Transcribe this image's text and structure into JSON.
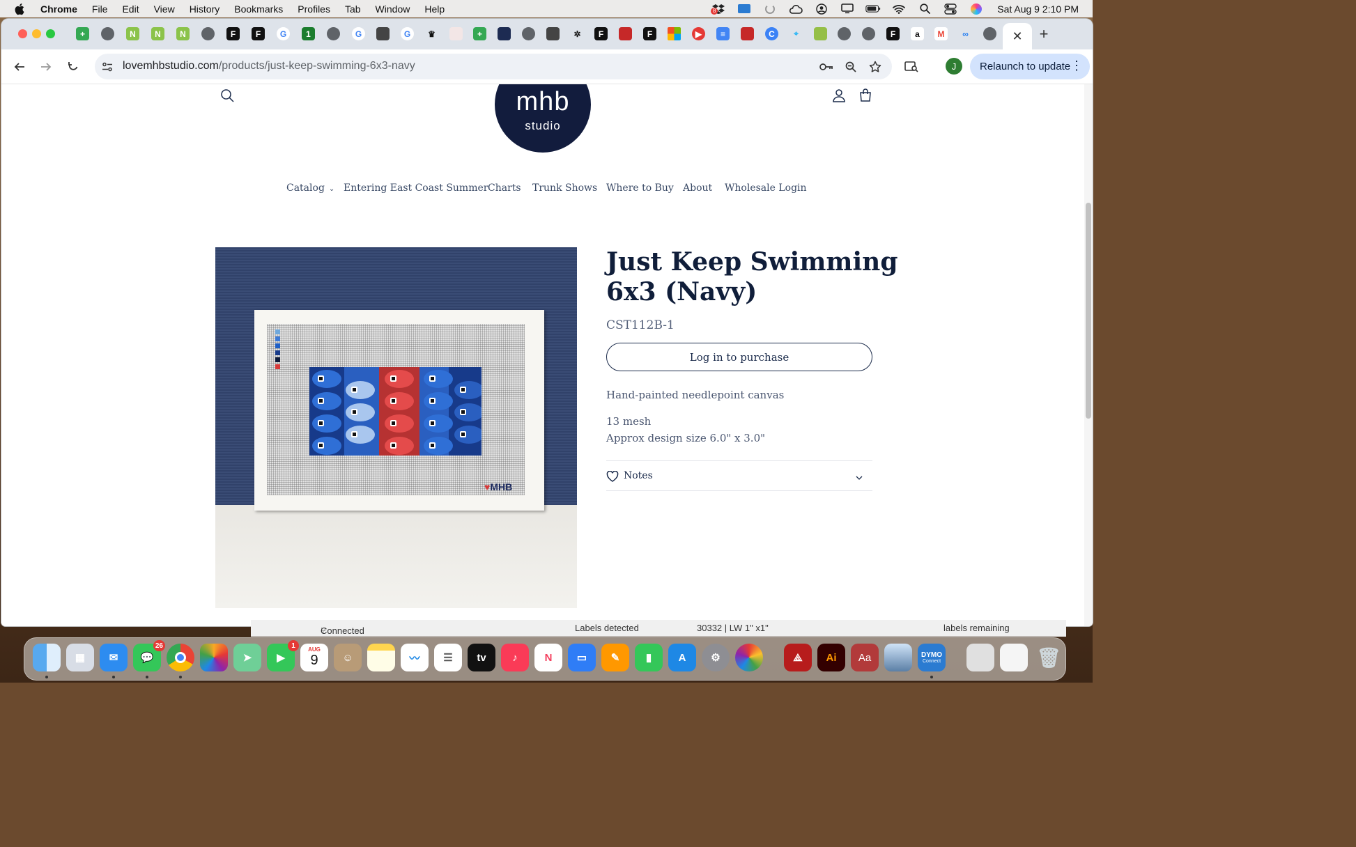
{
  "menubar": {
    "app": "Chrome",
    "items": [
      "File",
      "Edit",
      "View",
      "History",
      "Bookmarks",
      "Profiles",
      "Tab",
      "Window",
      "Help"
    ],
    "dropbox_badge": "8",
    "clock": "Sat Aug 9  2:10 PM"
  },
  "browser": {
    "url_domain": "lovemhbstudio.com",
    "url_path": "/products/just-keep-swimming-6x3-navy",
    "profile_initial": "J",
    "relaunch_label": "Relaunch to update",
    "active_tab_close": "✕",
    "new_tab": "+"
  },
  "site": {
    "logo_main": "mhb",
    "logo_sub": "studio",
    "nav": [
      "Catalog",
      "Entering East Coast Summer",
      "Charts",
      "Trunk Shows",
      "Where to Buy",
      "About",
      "Wholesale Login"
    ]
  },
  "product": {
    "title": "Just Keep Swimming 6x3 (Navy)",
    "sku": "CST112B-1",
    "login_button": "Log in to purchase",
    "desc_1": "Hand-painted needlepoint canvas",
    "desc_2": "13 mesh",
    "desc_3": "Approx design size 6.0\" x 3.0\"",
    "notes_label": "Notes",
    "canvas_mark": "MHB"
  },
  "background_app": {
    "status_1": "Connected",
    "status_2": "Labels detected",
    "status_3": "30332  |  LW 1\" x1\"",
    "status_4": "labels remaining"
  },
  "dock": {
    "messages_badge": "26",
    "facetime_badge": "1",
    "calendar_month": "AUG",
    "calendar_day": "9",
    "tv_label": "tv",
    "ai_label": "Ai",
    "dict_label": "Aa",
    "dymo_label": "DYMO",
    "dymo_sub": "Connect"
  },
  "colors": {
    "brand_navy": "#121c3d",
    "text_navy": "#1a2a4a",
    "chrome_tab_strip": "#dee3ea",
    "relaunch_bg": "#d3e3fd"
  }
}
